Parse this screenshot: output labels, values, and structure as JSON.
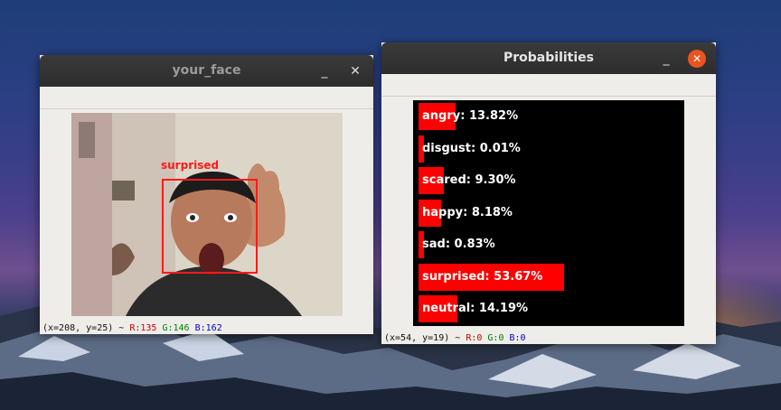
{
  "face_window": {
    "title": "your_face",
    "minimize_label": "_",
    "close_label": "✕",
    "detection_label": "surprised",
    "status": {
      "coords": "(x=208, y=25) ~ ",
      "r": "R:135",
      "g": "G:146",
      "b": "B:162"
    }
  },
  "prob_window": {
    "title": "Probabilities",
    "minimize_label": "_",
    "close_label": "✕",
    "status": {
      "coords": "(x=54, y=19) ~ ",
      "r": "R:0",
      "g": "G:0",
      "b": "B:0"
    },
    "emotions": [
      {
        "label": "angry: 13.82%",
        "value": 13.82
      },
      {
        "label": "disgust: 0.01%",
        "value": 0.01
      },
      {
        "label": "scared: 9.30%",
        "value": 9.3
      },
      {
        "label": "happy: 8.18%",
        "value": 8.18
      },
      {
        "label": "sad: 0.83%",
        "value": 0.83
      },
      {
        "label": "surprised: 53.67%",
        "value": 53.67
      },
      {
        "label": "neutral: 14.19%",
        "value": 14.19
      }
    ]
  },
  "colors": {
    "bar": "#ff0000",
    "detection": "#ff1a1a",
    "close_button": "#e95420"
  }
}
